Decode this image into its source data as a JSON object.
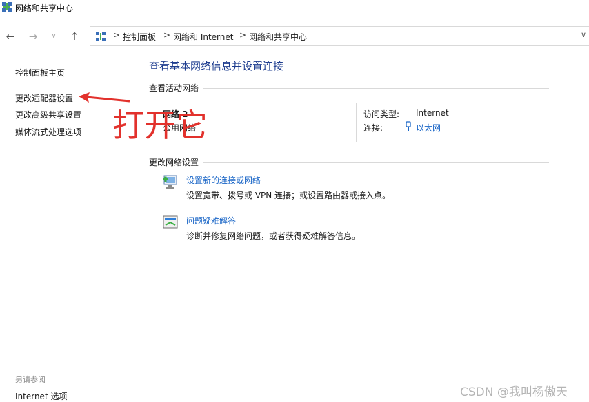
{
  "window": {
    "title": "网络和共享中心"
  },
  "nav": {
    "back_icon": "arrow-left-icon",
    "forward_icon": "arrow-right-icon",
    "recent_icon": "chevron-down-icon",
    "up_icon": "arrow-up-icon"
  },
  "address": {
    "crumbs": [
      "控制面板",
      "网络和 Internet",
      "网络和共享中心"
    ],
    "separator": ">"
  },
  "sidebar": {
    "links": [
      "控制面板主页",
      "更改适配器设置",
      "更改高级共享设置",
      "媒体流式处理选项"
    ],
    "see_also_heading": "另请参阅",
    "see_also_links": [
      "Internet 选项"
    ]
  },
  "main": {
    "title": "查看基本网络信息并设置连接",
    "active_heading": "查看活动网络",
    "network": {
      "name": "网络 2",
      "type": "公用网络",
      "access_label": "访问类型:",
      "access_value": "Internet",
      "connection_label": "连接:",
      "connection_value": "以太网"
    },
    "change_heading": "更改网络设置",
    "tasks": [
      {
        "link": "设置新的连接或网络",
        "desc": "设置宽带、拨号或 VPN 连接；或设置路由器或接入点。",
        "icon": "new-connection-icon"
      },
      {
        "link": "问题疑难解答",
        "desc": "诊断并修复网络问题，或者获得疑难解答信息。",
        "icon": "troubleshoot-icon"
      }
    ]
  },
  "annotation": {
    "text": "打开它",
    "color": "#e2312c"
  },
  "watermark": "CSDN @我叫杨傲天",
  "colors": {
    "title_blue": "#1e3d8f",
    "link_blue": "#1a66c7"
  }
}
